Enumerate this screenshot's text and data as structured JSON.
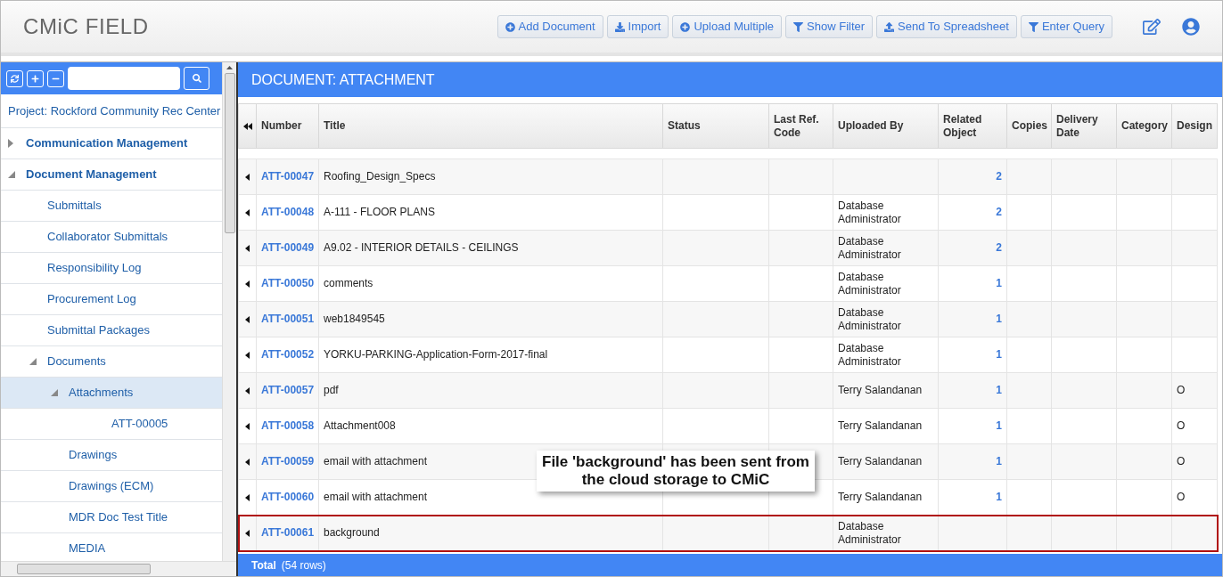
{
  "app": {
    "logo": "CMiC FIELD"
  },
  "toolbar": [
    {
      "label": "Add Document",
      "kind": "add"
    },
    {
      "label": "Import",
      "kind": "import"
    },
    {
      "label": "Upload Multiple",
      "kind": "add"
    },
    {
      "label": "Show Filter",
      "kind": "filter"
    },
    {
      "label": "Send To Spreadsheet",
      "kind": "export"
    },
    {
      "label": "Enter Query",
      "kind": "filter"
    }
  ],
  "sidebar": {
    "project": "Project: Rockford Community Rec Center",
    "tree": [
      {
        "label": "Communication Management",
        "expanded": false,
        "selected": false
      },
      {
        "label": "Document Management",
        "expanded": true,
        "selected": false,
        "children": [
          {
            "label": "Submittals",
            "selected": false
          },
          {
            "label": "Collaborator Submittals",
            "selected": false
          },
          {
            "label": "Responsibility Log",
            "selected": false
          },
          {
            "label": "Procurement Log",
            "selected": false
          },
          {
            "label": "Submittal Packages",
            "selected": false
          },
          {
            "label": "Documents",
            "expanded": true,
            "selected": false,
            "children": [
              {
                "label": "Attachments",
                "expanded": true,
                "selected": true,
                "children": [
                  {
                    "label": "ATT-00005",
                    "selected": false
                  }
                ]
              },
              {
                "label": "Drawings",
                "selected": false
              },
              {
                "label": "Drawings (ECM)",
                "selected": false
              },
              {
                "label": "MDR Doc Test Title",
                "selected": false
              },
              {
                "label": "MEDIA",
                "selected": false
              }
            ]
          }
        ]
      }
    ]
  },
  "panel": {
    "title": "DOCUMENT: ATTACHMENT"
  },
  "table": {
    "columns": [
      "Number",
      "Title",
      "Status",
      "Last Ref. Code",
      "Uploaded By",
      "Related Object",
      "Copies",
      "Delivery Date",
      "Category",
      "Design"
    ],
    "rows": [
      {
        "number": "ATT-00047",
        "title": "Roofing_Design_Specs",
        "uploaded_by": "",
        "related": "2",
        "design": "",
        "highlighted": false
      },
      {
        "number": "ATT-00048",
        "title": "A-111 - FLOOR PLANS",
        "uploaded_by": "Database Administrator",
        "related": "2",
        "design": "",
        "highlighted": false
      },
      {
        "number": "ATT-00049",
        "title": "A9.02 - INTERIOR DETAILS - CEILINGS",
        "uploaded_by": "Database Administrator",
        "related": "2",
        "design": "",
        "highlighted": false
      },
      {
        "number": "ATT-00050",
        "title": "comments",
        "uploaded_by": "Database Administrator",
        "related": "1",
        "design": "",
        "highlighted": false
      },
      {
        "number": "ATT-00051",
        "title": "web1849545",
        "uploaded_by": "Database Administrator",
        "related": "1",
        "design": "",
        "highlighted": false
      },
      {
        "number": "ATT-00052",
        "title": "YORKU-PARKING-Application-Form-2017-final",
        "uploaded_by": "Database Administrator",
        "related": "1",
        "design": "",
        "highlighted": false
      },
      {
        "number": "ATT-00057",
        "title": "pdf",
        "uploaded_by": "Terry Salandanan",
        "related": "1",
        "design": "O",
        "highlighted": false
      },
      {
        "number": "ATT-00058",
        "title": "Attachment008",
        "uploaded_by": "Terry Salandanan",
        "related": "1",
        "design": "O",
        "highlighted": false
      },
      {
        "number": "ATT-00059",
        "title": "email with attachment",
        "uploaded_by": "Terry Salandanan",
        "related": "1",
        "design": "O",
        "highlighted": false
      },
      {
        "number": "ATT-00060",
        "title": "email with attachment",
        "uploaded_by": "Terry Salandanan",
        "related": "1",
        "design": "O",
        "highlighted": false
      },
      {
        "number": "ATT-00061",
        "title": "background",
        "uploaded_by": "Database Administrator",
        "related": "",
        "design": "",
        "highlighted": true
      }
    ],
    "total_label": "Total",
    "total_count": "(54 rows)"
  },
  "callout": "File 'background' has been sent from the cloud storage to CMiC"
}
